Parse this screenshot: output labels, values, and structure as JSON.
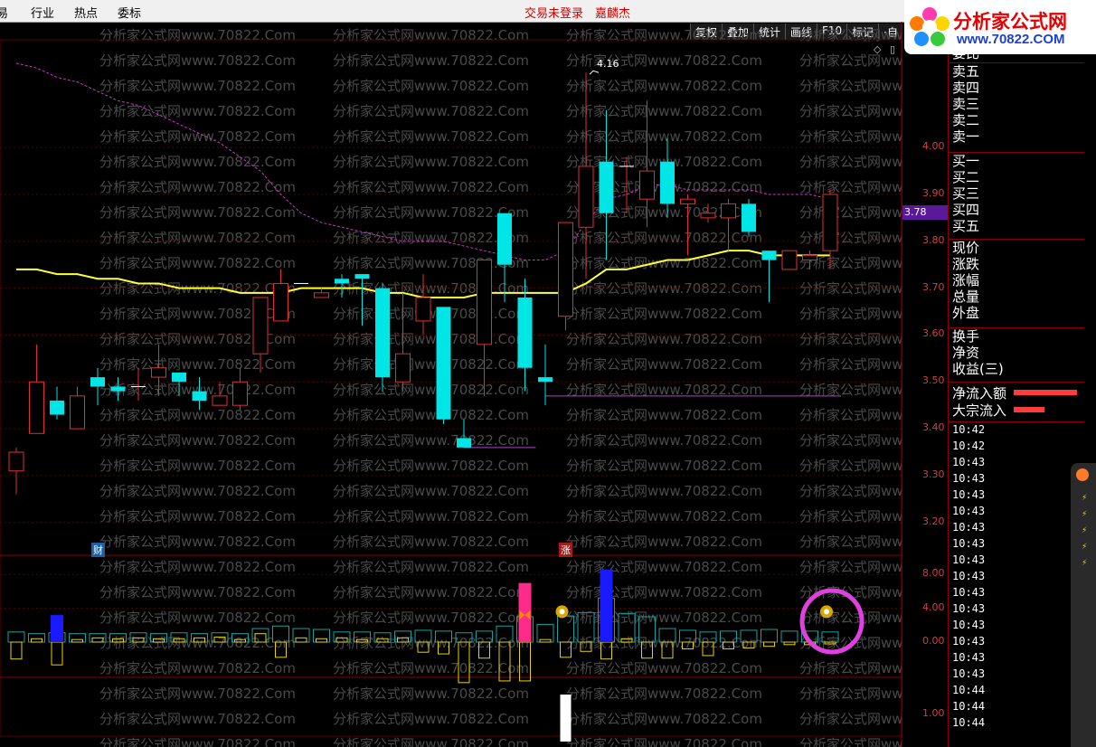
{
  "menu": {
    "items": [
      "易",
      "行业",
      "热点",
      "委标"
    ],
    "login_status": "交易未登录",
    "user_name": "嘉麟杰"
  },
  "toolbar": {
    "buttons": [
      "复权",
      "叠加",
      "统计",
      "画线",
      "F10",
      "标记",
      "·自"
    ]
  },
  "logo": {
    "title": "分析家公式网",
    "url": "www.70822.COM"
  },
  "watermark": "分析家公式网www.70822.Com",
  "price_axis": {
    "labels": [
      "4.00",
      "3.90",
      "3.80",
      "3.70",
      "3.60",
      "3.50",
      "3.40",
      "3.30",
      "3.20"
    ],
    "current_price": "3.78"
  },
  "indicator_axis": {
    "labels": [
      "8.00",
      "4.00",
      "0.00",
      "1.00"
    ]
  },
  "chart_annotations": {
    "high_label": "4.16",
    "cai_badge": "财",
    "zhang_badge": "涨"
  },
  "right_panel": {
    "quote_labels": [
      "委比",
      "卖五",
      "卖四",
      "卖三",
      "卖二",
      "卖一",
      "买一",
      "买二",
      "买三",
      "买四",
      "买五",
      "现价",
      "涨跌",
      "涨幅",
      "总量",
      "外盘",
      "换手",
      "净资",
      "收益(三)"
    ],
    "flow_labels": [
      "净流入额",
      "大宗流入"
    ],
    "times": [
      "10:42",
      "10:42",
      "10:43",
      "10:43",
      "10:43",
      "10:43",
      "10:43",
      "10:43",
      "10:43",
      "10:43",
      "10:43",
      "10:43",
      "10:43",
      "10:43",
      "10:43",
      "10:43",
      "10:44",
      "10:44",
      "10:44"
    ]
  },
  "colors": {
    "up": "#e03030",
    "down": "#00e5e5",
    "ma_yellow": "#ffff33",
    "ma_magenta": "#cc33cc",
    "grid": "#5a0000",
    "highlight_circle": "#e040e0"
  },
  "chart_data": {
    "type": "candlestick",
    "y_range": [
      3.13,
      4.23
    ],
    "candles": [
      {
        "o": 3.31,
        "h": 3.36,
        "l": 3.26,
        "c": 3.35
      },
      {
        "o": 3.39,
        "h": 3.58,
        "l": 3.39,
        "c": 3.5
      },
      {
        "o": 3.46,
        "h": 3.49,
        "l": 3.42,
        "c": 3.43
      },
      {
        "o": 3.4,
        "h": 3.49,
        "l": 3.4,
        "c": 3.47
      },
      {
        "o": 3.51,
        "h": 3.53,
        "l": 3.45,
        "c": 3.49
      },
      {
        "o": 3.49,
        "h": 3.51,
        "l": 3.46,
        "c": 3.48
      },
      {
        "o": 3.49,
        "h": 3.53,
        "l": 3.46,
        "c": 3.49
      },
      {
        "o": 3.51,
        "h": 3.58,
        "l": 3.47,
        "c": 3.53
      },
      {
        "o": 3.52,
        "h": 3.52,
        "l": 3.47,
        "c": 3.5
      },
      {
        "o": 3.48,
        "h": 3.51,
        "l": 3.44,
        "c": 3.46
      },
      {
        "o": 3.45,
        "h": 3.5,
        "l": 3.45,
        "c": 3.47
      },
      {
        "o": 3.45,
        "h": 3.53,
        "l": 3.44,
        "c": 3.5
      },
      {
        "o": 3.56,
        "h": 3.68,
        "l": 3.52,
        "c": 3.68
      },
      {
        "o": 3.63,
        "h": 3.74,
        "l": 3.63,
        "c": 3.71
      },
      {
        "o": 3.71,
        "h": 3.71,
        "l": 3.71,
        "c": 3.71
      },
      {
        "o": 3.68,
        "h": 3.7,
        "l": 3.68,
        "c": 3.69
      },
      {
        "o": 3.72,
        "h": 3.73,
        "l": 3.68,
        "c": 3.71
      },
      {
        "o": 3.73,
        "h": 3.73,
        "l": 3.62,
        "c": 3.72
      },
      {
        "o": 3.7,
        "h": 3.71,
        "l": 3.48,
        "c": 3.51
      },
      {
        "o": 3.5,
        "h": 3.69,
        "l": 3.48,
        "c": 3.56
      },
      {
        "o": 3.63,
        "h": 3.73,
        "l": 3.6,
        "c": 3.68
      },
      {
        "o": 3.66,
        "h": 3.66,
        "l": 3.41,
        "c": 3.42
      },
      {
        "o": 3.38,
        "h": 3.42,
        "l": 3.36,
        "c": 3.36
      },
      {
        "o": 3.58,
        "h": 3.76,
        "l": 3.47,
        "c": 3.76
      },
      {
        "o": 3.86,
        "h": 3.86,
        "l": 3.67,
        "c": 3.75
      },
      {
        "o": 3.68,
        "h": 3.72,
        "l": 3.48,
        "c": 3.53
      },
      {
        "o": 3.51,
        "h": 3.58,
        "l": 3.45,
        "c": 3.5
      },
      {
        "o": 3.64,
        "h": 3.84,
        "l": 3.61,
        "c": 3.84
      },
      {
        "o": 3.83,
        "h": 4.16,
        "l": 3.72,
        "c": 3.96
      },
      {
        "o": 3.97,
        "h": 4.08,
        "l": 3.76,
        "c": 3.86
      },
      {
        "o": 3.96,
        "h": 3.98,
        "l": 3.86,
        "c": 3.96
      },
      {
        "o": 3.89,
        "h": 4.1,
        "l": 3.83,
        "c": 3.95
      },
      {
        "o": 3.97,
        "h": 4.02,
        "l": 3.85,
        "c": 3.88
      },
      {
        "o": 3.88,
        "h": 3.9,
        "l": 3.77,
        "c": 3.89
      },
      {
        "o": 3.85,
        "h": 3.88,
        "l": 3.84,
        "c": 3.86
      },
      {
        "o": 3.85,
        "h": 3.89,
        "l": 3.78,
        "c": 3.88
      },
      {
        "o": 3.88,
        "h": 3.89,
        "l": 3.81,
        "c": 3.82
      },
      {
        "o": 3.78,
        "h": 3.78,
        "l": 3.67,
        "c": 3.76
      },
      {
        "o": 3.74,
        "h": 3.78,
        "l": 3.74,
        "c": 3.78
      },
      {
        "o": 3.76,
        "h": 3.78,
        "l": 3.74,
        "c": 3.77
      },
      {
        "o": 3.78,
        "h": 3.91,
        "l": 3.74,
        "c": 3.9
      }
    ],
    "ma_yellow": [
      3.74,
      3.74,
      3.73,
      3.73,
      3.72,
      3.72,
      3.71,
      3.71,
      3.7,
      3.7,
      3.7,
      3.69,
      3.69,
      3.69,
      3.7,
      3.7,
      3.7,
      3.7,
      3.69,
      3.69,
      3.68,
      3.68,
      3.68,
      3.69,
      3.69,
      3.69,
      3.69,
      3.69,
      3.71,
      3.74,
      3.74,
      3.75,
      3.76,
      3.76,
      3.77,
      3.78,
      3.78,
      3.77,
      3.77,
      3.77,
      3.77
    ],
    "ma_magenta": [
      4.18,
      4.17,
      4.15,
      4.14,
      4.12,
      4.1,
      4.09,
      4.07,
      4.05,
      4.03,
      4.01,
      3.98,
      3.95,
      3.9,
      3.86,
      3.84,
      3.83,
      3.82,
      3.81,
      3.8,
      3.8,
      3.8,
      3.79,
      3.78,
      3.77,
      3.76,
      3.76,
      3.78,
      3.84,
      3.89,
      3.9,
      3.92,
      3.92,
      3.91,
      3.91,
      3.91,
      3.91,
      3.9,
      3.9,
      3.9,
      3.89
    ],
    "indicator_range": [
      -2,
      9
    ],
    "ind_cyan": [
      1.2,
      1.0,
      1.1,
      1.0,
      1.0,
      1.0,
      1.1,
      1.0,
      1.1,
      1.0,
      1.1,
      1.0,
      1.6,
      1.9,
      1.6,
      1.5,
      1.2,
      1.2,
      1.1,
      1.3,
      1.4,
      1.3,
      1.1,
      1.3,
      1.9,
      3.0,
      2.1,
      3.1,
      3.5,
      5.2,
      3.4,
      3.0,
      1.6,
      1.4,
      1.2,
      1.3,
      1.4,
      1.5,
      1.3,
      1.3,
      1.2
    ],
    "ind_yellow": [
      -2.0,
      0.4,
      -2.7,
      0.3,
      0.5,
      0.4,
      0.5,
      0.4,
      0.4,
      0.5,
      0.6,
      0.3,
      1.0,
      -1.8,
      0.5,
      0.4,
      0.5,
      0.3,
      0.4,
      0.5,
      -1.2,
      -1.4,
      -4.8,
      -1.9,
      -4.6,
      -4.6,
      0.3,
      -1.8,
      -1.1,
      -2.0,
      0.4,
      -1.9,
      -1.9,
      -0.8,
      -1.6,
      -0.8,
      -0.7,
      -0.5,
      -0.3,
      -0.3,
      -0.2
    ],
    "ind_blue": [
      {
        "i": 2,
        "v": 3.2
      },
      {
        "i": 29,
        "v": 8.6
      }
    ],
    "ind_pink": {
      "i": 25,
      "v": 7.0
    },
    "ind_white": {
      "i": 27,
      "v": -11.0
    },
    "moneybags": [
      {
        "i": 27,
        "v": 3.6
      },
      {
        "i": 40,
        "v": 3.6
      }
    ],
    "support_lines": [
      {
        "from": 22,
        "to": 25,
        "y": 3.36
      },
      {
        "from": 26,
        "to": 40,
        "y": 3.47
      }
    ]
  }
}
